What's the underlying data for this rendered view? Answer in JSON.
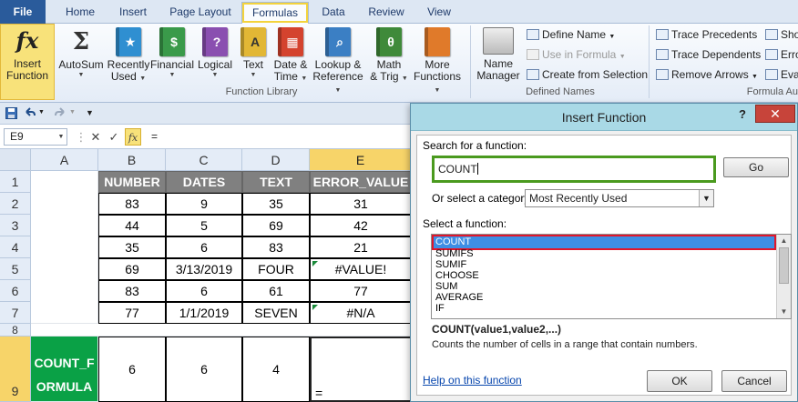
{
  "ribbon": {
    "tabs": [
      "File",
      "Home",
      "Insert",
      "Page Layout",
      "Formulas",
      "Data",
      "Review",
      "View"
    ],
    "active_tab": "Formulas",
    "insert_function": [
      "Insert",
      "Function"
    ],
    "function_library": {
      "buttons": [
        {
          "l1": "AutoSum",
          "l2": "",
          "icon": "sigma-icon"
        },
        {
          "l1": "Recently",
          "l2": "Used",
          "icon": "star-book-icon",
          "color": "#2f8fd1"
        },
        {
          "l1": "Financial",
          "l2": "",
          "icon": "financial-book-icon",
          "color": "#3a9a4a"
        },
        {
          "l1": "Logical",
          "l2": "",
          "icon": "logical-book-icon",
          "color": "#8a4fb0"
        },
        {
          "l1": "Text",
          "l2": "",
          "icon": "text-book-icon",
          "color": "#e2b735"
        },
        {
          "l1": "Date &",
          "l2": "Time",
          "icon": "datetime-book-icon",
          "color": "#d4432e"
        },
        {
          "l1": "Lookup &",
          "l2": "Reference",
          "icon": "lookup-book-icon",
          "color": "#3b7fc4"
        },
        {
          "l1": "Math",
          "l2": "& Trig",
          "icon": "math-book-icon",
          "color": "#3f8a3a"
        },
        {
          "l1": "More",
          "l2": "Functions",
          "icon": "more-books-icon",
          "color": "#e07a2a"
        }
      ],
      "label": "Function Library",
      "glyphs": {
        "recent": "★",
        "financial": "$",
        "logical": "?",
        "text": "A",
        "date": "▦",
        "lookup": "⌕",
        "math": "θ",
        "more": ""
      }
    },
    "defined_names": {
      "name_manager": [
        "Name",
        "Manager"
      ],
      "define_name": "Define Name",
      "use_in_formula": "Use in Formula",
      "create_from_selection": "Create from Selection",
      "label": "Defined Names"
    },
    "formula_auditing": {
      "trace_precedents": "Trace Precedents",
      "trace_dependents": "Trace Dependents",
      "remove_arrows": "Remove Arrows",
      "show": "Sho",
      "error": "Erro",
      "evaluate": "Eva",
      "label": "Formula Au"
    }
  },
  "formula_bar": {
    "name_box": "E9",
    "cancel": "✕",
    "enter": "✓",
    "fx": "fx",
    "formula": "="
  },
  "sheet": {
    "columns": [
      "A",
      "B",
      "C",
      "D",
      "E"
    ],
    "rows": [
      "1",
      "2",
      "3",
      "4",
      "5",
      "6",
      "7",
      "8",
      "9"
    ],
    "header": [
      "NUMBER",
      "DATES",
      "TEXT",
      "ERROR_VALUE"
    ],
    "data": [
      [
        "83",
        "9",
        "35",
        "31"
      ],
      [
        "44",
        "5",
        "69",
        "42"
      ],
      [
        "35",
        "6",
        "83",
        "21"
      ],
      [
        "69",
        "3/13/2019",
        "FOUR",
        "#VALUE!"
      ],
      [
        "83",
        "6",
        "61",
        "77"
      ],
      [
        "77",
        "1/1/2019",
        "SEVEN",
        "#N/A"
      ]
    ],
    "count_label": [
      "COUNT_F",
      "ORMULA"
    ],
    "count_results": [
      "6",
      "6",
      "4"
    ],
    "active_cell_value": "="
  },
  "dialog": {
    "title": "Insert Function",
    "help": "?",
    "close": "✕",
    "search_label": "Search for a function:",
    "search_value": "COUNT",
    "go": "Go",
    "category_label": "Or select a category:",
    "category_value": "Most Recently Used",
    "select_label": "Select a function:",
    "functions": [
      "COUNT",
      "SUMIFS",
      "SUMIF",
      "CHOOSE",
      "SUM",
      "AVERAGE",
      "IF"
    ],
    "selected_function": "COUNT",
    "syntax": "COUNT(value1,value2,...)",
    "description": "Counts the number of cells in a range that contain numbers.",
    "help_link": "Help on this function",
    "ok": "OK",
    "cancel": "Cancel"
  }
}
